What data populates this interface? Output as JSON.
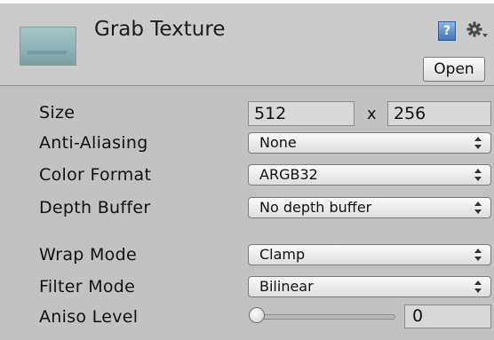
{
  "header": {
    "title": "Grab Texture",
    "thumbnail_icon": "texture-preview-icon",
    "help_icon": "help-book-icon",
    "help_glyph": "?",
    "settings_icon": "gear-dropdown-icon",
    "open_label": "Open"
  },
  "properties": {
    "size": {
      "label": "Size",
      "width": "512",
      "separator": "x",
      "height": "256"
    },
    "anti_aliasing": {
      "label": "Anti-Aliasing",
      "value": "None"
    },
    "color_format": {
      "label": "Color Format",
      "value": "ARGB32"
    },
    "depth_buffer": {
      "label": "Depth Buffer",
      "value": "No depth buffer"
    },
    "wrap_mode": {
      "label": "Wrap Mode",
      "value": "Clamp"
    },
    "filter_mode": {
      "label": "Filter Mode",
      "value": "Bilinear"
    },
    "aniso_level": {
      "label": "Aniso Level",
      "value": "0",
      "slider_fraction": 0.0
    }
  },
  "colors": {
    "panel_bg": "#c2c2c2",
    "header_bg": "#cbcbcb",
    "help_blue": "#3f75b8"
  }
}
